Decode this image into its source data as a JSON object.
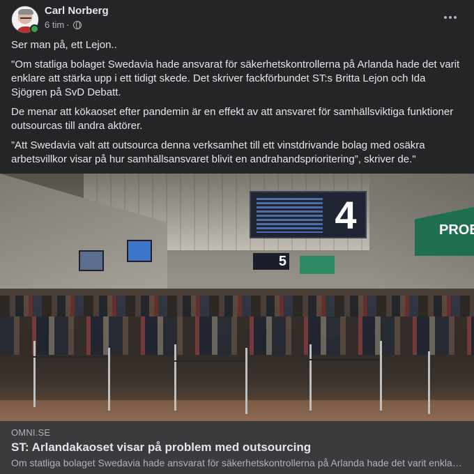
{
  "post": {
    "author": "Carl Norberg",
    "time": "6 tim",
    "separator": "·",
    "privacy_icon": "globe-icon",
    "paragraphs": [
      "Ser man på, ett Lejon..",
      "\"Om statliga bolaget Swedavia hade ansvarat för säkerhetskontrollerna på Arlanda hade det varit enklare att stärka upp i ett tidigt skede. Det skriver fackförbundet ST:s Britta Lejon och Ida Sjögren på SvD Debatt.",
      "De menar att kökaoset efter pandemin är en effekt av att ansvaret för samhällsviktiga funktioner outsourcas till andra aktörer.",
      "”Att Swedavia valt att outsourca denna verksamhet till ett vinstdrivande bolag med osäkra arbetsvillkor visar på hur samhällsansvaret blivit en andrahandsprioritering”, skriver de.\""
    ]
  },
  "photo": {
    "gate_number": "4",
    "gate_number_2": "5",
    "sign_text": "PROBA"
  },
  "link_preview": {
    "domain": "OMNI.SE",
    "title": "ST: Arlandakaoset visar på problem med outsourcing",
    "description": "Om statliga bolaget Swedavia hade ansvarat för säkerhetskontrollerna på Arlanda hade det varit enklare att stärka upp i ett tidigt skede."
  },
  "colors": {
    "background": "#242526",
    "online": "#31a24c",
    "link_preview_bg": "#3a3b3c"
  }
}
